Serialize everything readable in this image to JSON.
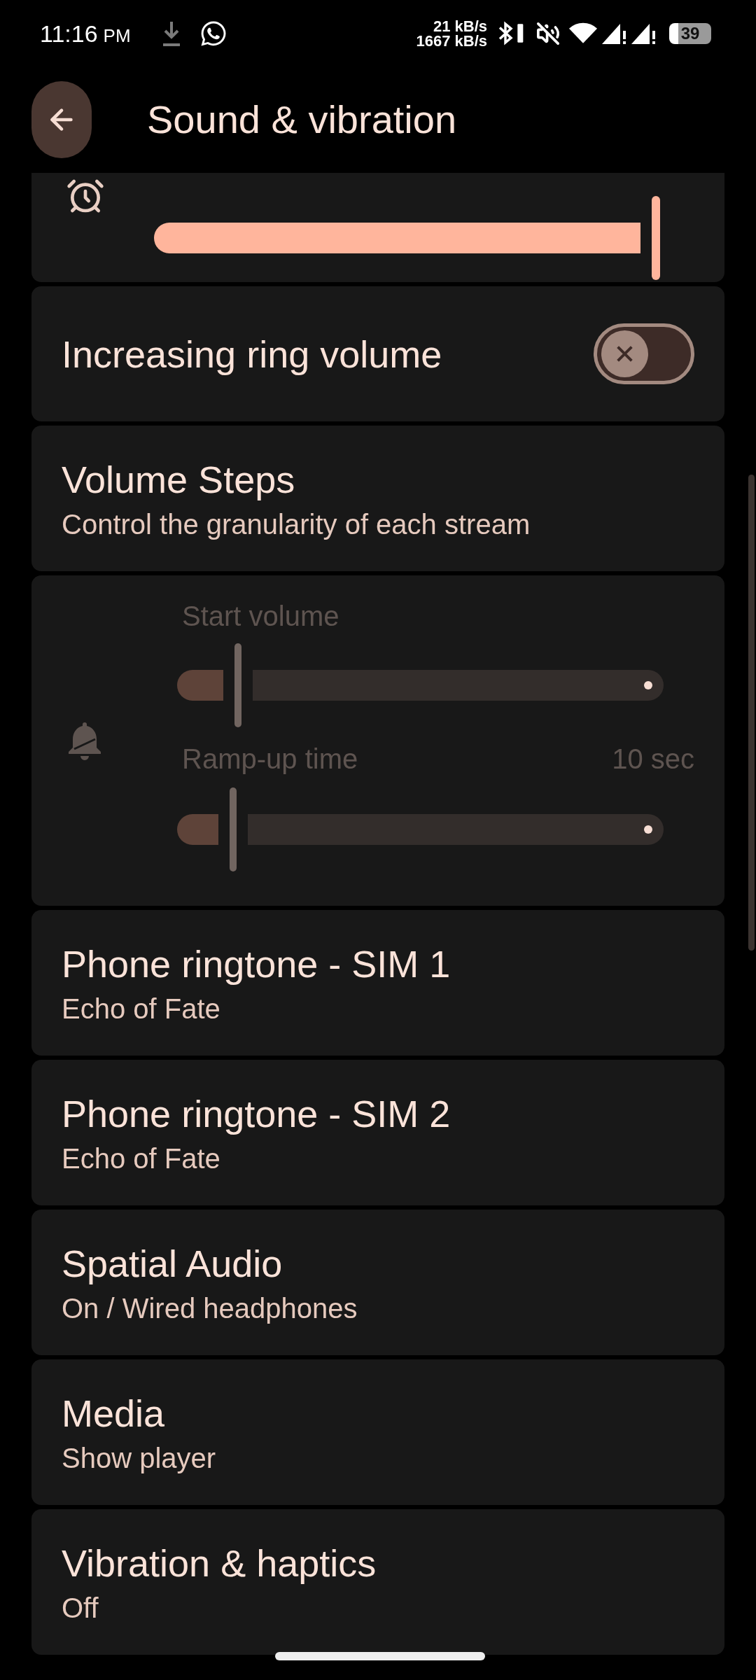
{
  "status_bar": {
    "time": "11:16",
    "meridiem": "PM",
    "upload_speed": "21 kB/s",
    "download_speed": "1667 kB/s",
    "battery": "39"
  },
  "header": {
    "title": "Sound & vibration"
  },
  "settings": [
    {
      "kind": "volume",
      "level": 1
    },
    {
      "kind": "switch",
      "title": "Increasing ring volume",
      "on": false
    },
    {
      "kind": "link",
      "title": "Volume Steps",
      "subtitle": "Control the granularity of each stream"
    },
    {
      "kind": "ramp",
      "disabled": true,
      "sliders": [
        {
          "label": "Start volume",
          "level": 0.12
        },
        {
          "label": "Ramp-up time",
          "reading": "10 sec",
          "level": 0.11
        }
      ]
    },
    {
      "kind": "link",
      "title": "Phone ringtone - SIM 1",
      "subtitle": "Echo of Fate"
    },
    {
      "kind": "link",
      "title": "Phone ringtone - SIM 2",
      "subtitle": "Echo of Fate"
    },
    {
      "kind": "link",
      "title": "Spatial Audio",
      "subtitle": "On / Wired headphones"
    },
    {
      "kind": "link",
      "title": "Media",
      "subtitle": "Show player"
    },
    {
      "kind": "link",
      "title": "Vibration & haptics",
      "subtitle": "Off"
    }
  ]
}
